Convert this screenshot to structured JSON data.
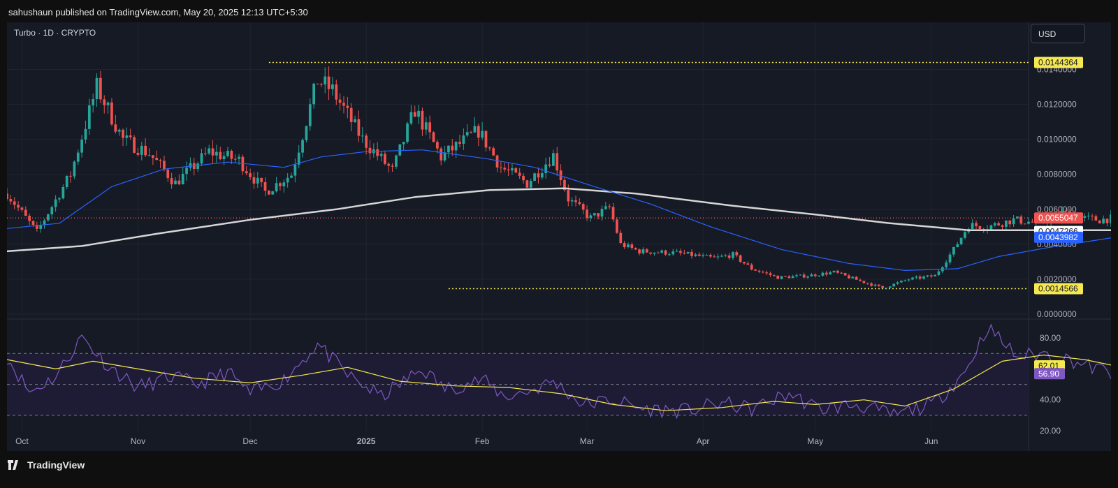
{
  "header": {
    "published": "sahushaun published on TradingView.com, May 20, 2025 12:13 UTC+5:30"
  },
  "footer": {
    "brand": "TradingView"
  },
  "toolbar": {
    "currency": "USD"
  },
  "chart_data": [
    {
      "type": "candlestick",
      "title": "Turbo · 1D · CRYPTO",
      "y_ticks": [
        "0.0000000",
        "0.0020000",
        "0.0040000",
        "0.0060000",
        "0.0080000",
        "0.0100000",
        "0.0120000",
        "0.0140000"
      ],
      "ylim": [
        0,
        0.0155
      ],
      "x_ticks": [
        "Oct",
        "Nov",
        "Dec",
        "2025",
        "Feb",
        "Mar",
        "Apr",
        "May",
        "Jun"
      ],
      "price_path": [
        [
          "2024-09-27",
          0.0069
        ],
        [
          "2024-10-05",
          0.0047
        ],
        [
          "2024-10-14",
          0.008
        ],
        [
          "2024-10-21",
          0.013
        ],
        [
          "2024-10-28",
          0.01
        ],
        [
          "2024-11-04",
          0.0092
        ],
        [
          "2024-11-11",
          0.0075
        ],
        [
          "2024-11-20",
          0.0093
        ],
        [
          "2024-11-28",
          0.0088
        ],
        [
          "2024-12-05",
          0.007
        ],
        [
          "2024-12-12",
          0.008
        ],
        [
          "2024-12-19",
          0.0134
        ],
        [
          "2024-12-23",
          0.0128
        ],
        [
          "2024-12-31",
          0.01
        ],
        [
          "2025-01-08",
          0.0082
        ],
        [
          "2025-01-14",
          0.0117
        ],
        [
          "2025-01-21",
          0.009
        ],
        [
          "2025-01-31",
          0.0105
        ],
        [
          "2025-02-06",
          0.0084
        ],
        [
          "2025-02-13",
          0.0075
        ],
        [
          "2025-02-20",
          0.0091
        ],
        [
          "2025-02-24",
          0.0066
        ],
        [
          "2025-03-02",
          0.0055
        ],
        [
          "2025-03-07",
          0.0061
        ],
        [
          "2025-03-10",
          0.004
        ],
        [
          "2025-03-15",
          0.0036
        ],
        [
          "2025-03-25",
          0.0035
        ],
        [
          "2025-04-04",
          0.0032
        ],
        [
          "2025-04-09",
          0.0034
        ],
        [
          "2025-04-14",
          0.0026
        ],
        [
          "2025-04-21",
          0.0021
        ],
        [
          "2025-04-29",
          0.0022
        ],
        [
          "2025-05-06",
          0.0024
        ],
        [
          "2025-05-13",
          0.0019
        ],
        [
          "2025-05-19",
          0.0015
        ],
        [
          "2025-05-26",
          0.002
        ],
        [
          "2025-06-02",
          0.0022
        ],
        [
          "2025-06-07",
          0.0037
        ],
        [
          "2025-06-11",
          0.0051
        ],
        [
          "2025-06-16",
          0.005
        ],
        [
          "2025-06-23",
          0.0054
        ],
        [
          "2025-06-30",
          0.0052
        ],
        [
          "2025-07-06",
          0.0058
        ],
        [
          "2025-07-11",
          0.0055
        ],
        [
          "2025-07-16",
          0.0054
        ],
        [
          "2025-07-20",
          0.0055
        ]
      ],
      "ma_fast_path": [
        [
          "2024-09-27",
          0.0049
        ],
        [
          "2024-10-11",
          0.0052
        ],
        [
          "2024-10-25",
          0.0073
        ],
        [
          "2024-11-08",
          0.0083
        ],
        [
          "2024-11-25",
          0.0087
        ],
        [
          "2024-12-10",
          0.0084
        ],
        [
          "2024-12-20",
          0.009
        ],
        [
          "2025-01-01",
          0.0093
        ],
        [
          "2025-01-16",
          0.0094
        ],
        [
          "2025-02-02",
          0.0089
        ],
        [
          "2025-02-15",
          0.0084
        ],
        [
          "2025-03-03",
          0.0073
        ],
        [
          "2025-03-18",
          0.0063
        ],
        [
          "2025-04-03",
          0.005
        ],
        [
          "2025-04-22",
          0.0037
        ],
        [
          "2025-05-10",
          0.0029
        ],
        [
          "2025-05-25",
          0.0025
        ],
        [
          "2025-06-08",
          0.0026
        ],
        [
          "2025-06-19",
          0.0033
        ],
        [
          "2025-07-02",
          0.0038
        ],
        [
          "2025-07-20",
          0.0044
        ]
      ],
      "ma_slow_path": [
        [
          "2024-09-27",
          0.0036
        ],
        [
          "2024-10-17",
          0.0039
        ],
        [
          "2024-11-06",
          0.0046
        ],
        [
          "2024-12-01",
          0.0054
        ],
        [
          "2024-12-24",
          0.006
        ],
        [
          "2025-01-14",
          0.0067
        ],
        [
          "2025-02-03",
          0.0071
        ],
        [
          "2025-02-23",
          0.0072
        ],
        [
          "2025-03-14",
          0.0069
        ],
        [
          "2025-04-09",
          0.0062
        ],
        [
          "2025-05-01",
          0.0057
        ],
        [
          "2025-05-21",
          0.0052
        ],
        [
          "2025-06-11",
          0.0048
        ],
        [
          "2025-07-01",
          0.0048
        ],
        [
          "2025-07-20",
          0.0048
        ]
      ],
      "reference_lines": [
        {
          "value": 0.0144,
          "label": "0.0144364",
          "color": "#f5e851"
        },
        {
          "value": 0.0014566,
          "label": "0.0014566",
          "color": "#f5e851"
        },
        {
          "value": 0.0055047,
          "label": "0.0055047",
          "color": "#ef5350"
        }
      ],
      "price_labels": [
        {
          "value": 0.0055047,
          "label": "0.0055047",
          "bg": "#ef5350",
          "fg": "#ffffff"
        },
        {
          "value": 0.0047266,
          "label": "0.0047266",
          "bg": "#ffffff",
          "fg": "#131722"
        },
        {
          "value": 0.0043982,
          "label": "0.0043982",
          "bg": "#2962ff",
          "fg": "#ffffff"
        },
        {
          "value": 0.0014566,
          "label": "0.0014566",
          "bg": "#f5e851",
          "fg": "#131722"
        }
      ],
      "colors": {
        "up": "#26a69a",
        "down": "#ef5350",
        "ma_fast": "#2962ff",
        "ma_slow": "#d6d6d6",
        "grid": "#1f2430"
      }
    },
    {
      "type": "line",
      "y_ticks": [
        "20.00",
        "40.00",
        "60.00",
        "80.00"
      ],
      "ylim": [
        20,
        90
      ],
      "bands": [
        30,
        50,
        70
      ],
      "rsi_path": [
        [
          "2024-09-27",
          68
        ],
        [
          "2024-10-03",
          45
        ],
        [
          "2024-10-10",
          55
        ],
        [
          "2024-10-17",
          81
        ],
        [
          "2024-10-24",
          62
        ],
        [
          "2024-11-01",
          48
        ],
        [
          "2024-11-10",
          55
        ],
        [
          "2024-11-17",
          50
        ],
        [
          "2024-11-25",
          58
        ],
        [
          "2024-12-01",
          44
        ],
        [
          "2024-12-10",
          53
        ],
        [
          "2024-12-19",
          76
        ],
        [
          "2024-12-27",
          56
        ],
        [
          "2025-01-05",
          42
        ],
        [
          "2025-01-16",
          60
        ],
        [
          "2025-01-22",
          47
        ],
        [
          "2025-02-01",
          53
        ],
        [
          "2025-02-07",
          42
        ],
        [
          "2025-02-14",
          46
        ],
        [
          "2025-02-20",
          52
        ],
        [
          "2025-02-28",
          37
        ],
        [
          "2025-03-08",
          40
        ],
        [
          "2025-03-16",
          34
        ],
        [
          "2025-03-28",
          33
        ],
        [
          "2025-04-06",
          38
        ],
        [
          "2025-04-14",
          34
        ],
        [
          "2025-04-24",
          44
        ],
        [
          "2025-05-02",
          34
        ],
        [
          "2025-05-12",
          37
        ],
        [
          "2025-05-22",
          30
        ],
        [
          "2025-06-02",
          38
        ],
        [
          "2025-06-10",
          58
        ],
        [
          "2025-06-16",
          87
        ],
        [
          "2025-06-24",
          68
        ],
        [
          "2025-07-01",
          70
        ],
        [
          "2025-07-08",
          66
        ],
        [
          "2025-07-14",
          61
        ],
        [
          "2025-07-20",
          57
        ]
      ],
      "signal_path": [
        [
          "2024-09-27",
          66
        ],
        [
          "2024-10-10",
          60
        ],
        [
          "2024-10-20",
          65
        ],
        [
          "2024-11-01",
          60
        ],
        [
          "2024-11-16",
          54
        ],
        [
          "2024-12-01",
          51
        ],
        [
          "2024-12-15",
          56
        ],
        [
          "2024-12-27",
          61
        ],
        [
          "2025-01-10",
          52
        ],
        [
          "2025-01-25",
          49
        ],
        [
          "2025-02-08",
          48
        ],
        [
          "2025-02-22",
          44
        ],
        [
          "2025-03-08",
          37
        ],
        [
          "2025-03-22",
          33
        ],
        [
          "2025-04-06",
          35
        ],
        [
          "2025-04-20",
          39
        ],
        [
          "2025-05-01",
          37
        ],
        [
          "2025-05-14",
          40
        ],
        [
          "2025-05-25",
          36
        ],
        [
          "2025-06-07",
          47
        ],
        [
          "2025-06-20",
          65
        ],
        [
          "2025-07-01",
          69
        ],
        [
          "2025-07-12",
          66
        ],
        [
          "2025-07-20",
          62
        ]
      ],
      "value_labels": [
        {
          "value": 62.01,
          "label": "62.01",
          "bg": "#f5e851",
          "fg": "#131722"
        },
        {
          "value": 56.9,
          "label": "56.90",
          "bg": "#7e57c2",
          "fg": "#ffffff"
        }
      ],
      "colors": {
        "rsi": "#7e57c2",
        "signal": "#f5e851",
        "band_fill": "#1e1c34"
      }
    }
  ]
}
